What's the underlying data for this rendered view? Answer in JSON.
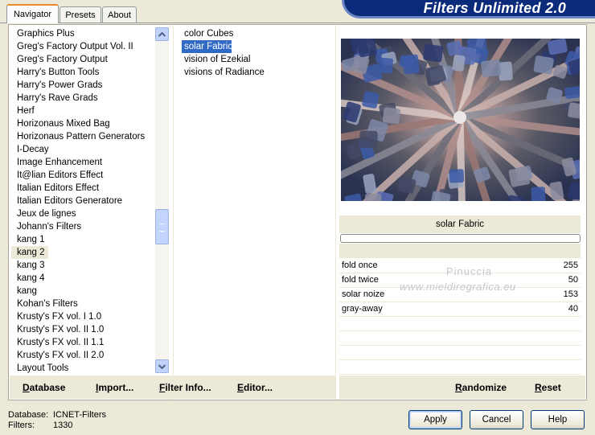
{
  "tabs": [
    {
      "label": "Navigator",
      "active": true
    },
    {
      "label": "Presets",
      "active": false
    },
    {
      "label": "About",
      "active": false
    }
  ],
  "banner_title": "Filters Unlimited 2.0",
  "categories": [
    "Graphics Plus",
    "Greg's Factory Output Vol. II",
    "Greg's Factory Output",
    "Harry's Button Tools",
    "Harry's Power Grads",
    "Harry's Rave Grads",
    "Herf",
    "Horizonaus Mixed Bag",
    "Horizonaus Pattern Generators",
    "I-Decay",
    "Image Enhancement",
    "It@lian Editors Effect",
    "Italian Editors Effect",
    "Italian Editors Generatore",
    "Jeux de lignes",
    "Johann's Filters",
    "kang 1",
    "kang 2",
    "kang 3",
    "kang 4",
    "kang",
    "Kohan's Filters",
    "Krusty's FX vol. I 1.0",
    "Krusty's FX vol. II 1.0",
    "Krusty's FX vol. II 1.1",
    "Krusty's FX vol. II 2.0",
    "Layout Tools"
  ],
  "selected_category_index": 17,
  "filters": [
    "color Cubes",
    "solar Fabric",
    "vision of Ezekial",
    "visions of Radiance"
  ],
  "selected_filter_index": 1,
  "selected_filter_title": "solar Fabric",
  "params": [
    {
      "label": "fold once",
      "value": "255"
    },
    {
      "label": "fold twice",
      "value": "50"
    },
    {
      "label": "solar noize",
      "value": "153"
    },
    {
      "label": "gray-away",
      "value": "40"
    }
  ],
  "watermark": {
    "line1": "Pinuccia",
    "line2": "www.mieldiregrafica.eu"
  },
  "toolbar": {
    "database": "Database",
    "import": "Import...",
    "filter_info": "Filter Info...",
    "editor": "Editor...",
    "randomize": "Randomize",
    "reset": "Reset"
  },
  "status": {
    "database_label": "Database:",
    "database_value": "ICNET-Filters",
    "filters_label": "Filters:",
    "filters_value": "1330"
  },
  "buttons": {
    "apply": "Apply",
    "cancel": "Cancel",
    "help": "Help"
  },
  "colors": {
    "selection": "#316ac5",
    "banner": "#0a2a7a",
    "tab_accent": "#e68b2c"
  }
}
